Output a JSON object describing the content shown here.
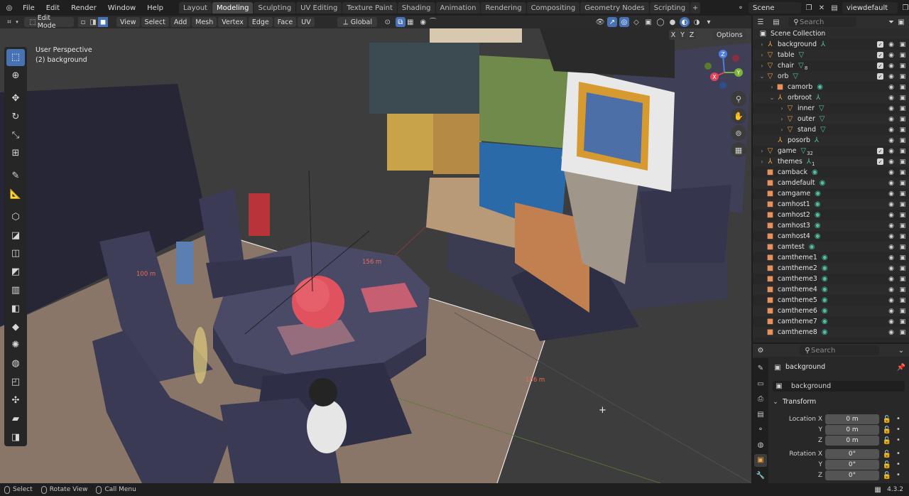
{
  "topbar": {
    "menus": [
      "File",
      "Edit",
      "Render",
      "Window",
      "Help"
    ],
    "workspaces": [
      "Layout",
      "Modeling",
      "Sculpting",
      "UV Editing",
      "Texture Paint",
      "Shading",
      "Animation",
      "Rendering",
      "Compositing",
      "Geometry Nodes",
      "Scripting"
    ],
    "active_workspace": "Modeling",
    "add_tab": "+",
    "scene": "Scene",
    "view_layer": "viewdefault"
  },
  "viewport_header": {
    "mode": "Edit Mode",
    "menus": [
      "View",
      "Select",
      "Add",
      "Mesh",
      "Vertex",
      "Edge",
      "Face",
      "UV"
    ],
    "orientation": "Global",
    "axis_x": "X",
    "axis_y": "Y",
    "axis_z": "Z",
    "options": "Options"
  },
  "viewport": {
    "perspective": "User Perspective",
    "object_info": "(2) background",
    "measure_left": "100 m",
    "measure_table": "156 m",
    "measure_right": "156 m",
    "gizmo_x": "X",
    "gizmo_y": "Y",
    "gizmo_z": "Z"
  },
  "outliner": {
    "search_placeholder": "Search",
    "root": "Scene Collection",
    "rows": [
      {
        "label": "background",
        "indent": 1,
        "type": "obj",
        "arrow": "›",
        "check": true
      },
      {
        "label": "table",
        "indent": 1,
        "type": "mesh",
        "arrow": "›",
        "check": true
      },
      {
        "label": "chair",
        "indent": 1,
        "type": "mesh",
        "arrow": "›",
        "check": true,
        "sub": "8"
      },
      {
        "label": "orb",
        "indent": 1,
        "type": "mesh",
        "arrow": "⌄",
        "check": true
      },
      {
        "label": "camorb",
        "indent": 2,
        "type": "cam",
        "arrow": "›",
        "check": false
      },
      {
        "label": "orbroot",
        "indent": 2,
        "type": "obj",
        "arrow": "⌄",
        "check": false
      },
      {
        "label": "inner",
        "indent": 3,
        "type": "mesh",
        "arrow": "›",
        "check": false
      },
      {
        "label": "outer",
        "indent": 3,
        "type": "mesh",
        "arrow": "›",
        "check": false
      },
      {
        "label": "stand",
        "indent": 3,
        "type": "mesh",
        "arrow": "›",
        "check": false
      },
      {
        "label": "posorb",
        "indent": 2,
        "type": "obj",
        "arrow": "",
        "check": false
      },
      {
        "label": "game",
        "indent": 1,
        "type": "mesh",
        "arrow": "›",
        "check": true,
        "sub": "32"
      },
      {
        "label": "themes",
        "indent": 1,
        "type": "obj",
        "arrow": "›",
        "check": true,
        "sub": "1"
      },
      {
        "label": "camback",
        "indent": 1,
        "type": "cam",
        "arrow": "",
        "check": false
      },
      {
        "label": "camdefault",
        "indent": 1,
        "type": "cam",
        "arrow": "",
        "check": false
      },
      {
        "label": "camgame",
        "indent": 1,
        "type": "cam",
        "arrow": "",
        "check": false
      },
      {
        "label": "camhost1",
        "indent": 1,
        "type": "cam",
        "arrow": "",
        "check": false
      },
      {
        "label": "camhost2",
        "indent": 1,
        "type": "cam",
        "arrow": "",
        "check": false
      },
      {
        "label": "camhost3",
        "indent": 1,
        "type": "cam",
        "arrow": "",
        "check": false
      },
      {
        "label": "camhost4",
        "indent": 1,
        "type": "cam",
        "arrow": "",
        "check": false
      },
      {
        "label": "camtest",
        "indent": 1,
        "type": "cam",
        "arrow": "",
        "check": false
      },
      {
        "label": "camtheme1",
        "indent": 1,
        "type": "cam",
        "arrow": "",
        "check": false
      },
      {
        "label": "camtheme2",
        "indent": 1,
        "type": "cam",
        "arrow": "",
        "check": false
      },
      {
        "label": "camtheme3",
        "indent": 1,
        "type": "cam",
        "arrow": "",
        "check": false
      },
      {
        "label": "camtheme4",
        "indent": 1,
        "type": "cam",
        "arrow": "",
        "check": false
      },
      {
        "label": "camtheme5",
        "indent": 1,
        "type": "cam",
        "arrow": "",
        "check": false
      },
      {
        "label": "camtheme6",
        "indent": 1,
        "type": "cam",
        "arrow": "",
        "check": false
      },
      {
        "label": "camtheme7",
        "indent": 1,
        "type": "cam",
        "arrow": "",
        "check": false
      },
      {
        "label": "camtheme8",
        "indent": 1,
        "type": "cam",
        "arrow": "",
        "check": false
      }
    ]
  },
  "properties": {
    "search_placeholder": "Search",
    "object_name": "background",
    "data_name": "background",
    "section": "Transform",
    "location_label": "Location X",
    "rotation_label": "Rotation X",
    "axis_y": "Y",
    "axis_z": "Z",
    "loc_x": "0 m",
    "loc_y": "0 m",
    "loc_z": "0 m",
    "rot_x": "0°",
    "rot_y": "0°",
    "rot_z": "0°"
  },
  "statusbar": {
    "select": "Select",
    "rotate": "Rotate View",
    "call_menu": "Call Menu",
    "version": "4.3.2"
  },
  "colors": {
    "accent_blue": "#4772b3",
    "object_orange": "#f0a24b",
    "data_teal": "#4fc2a5",
    "measure_red": "#f06a5c"
  }
}
